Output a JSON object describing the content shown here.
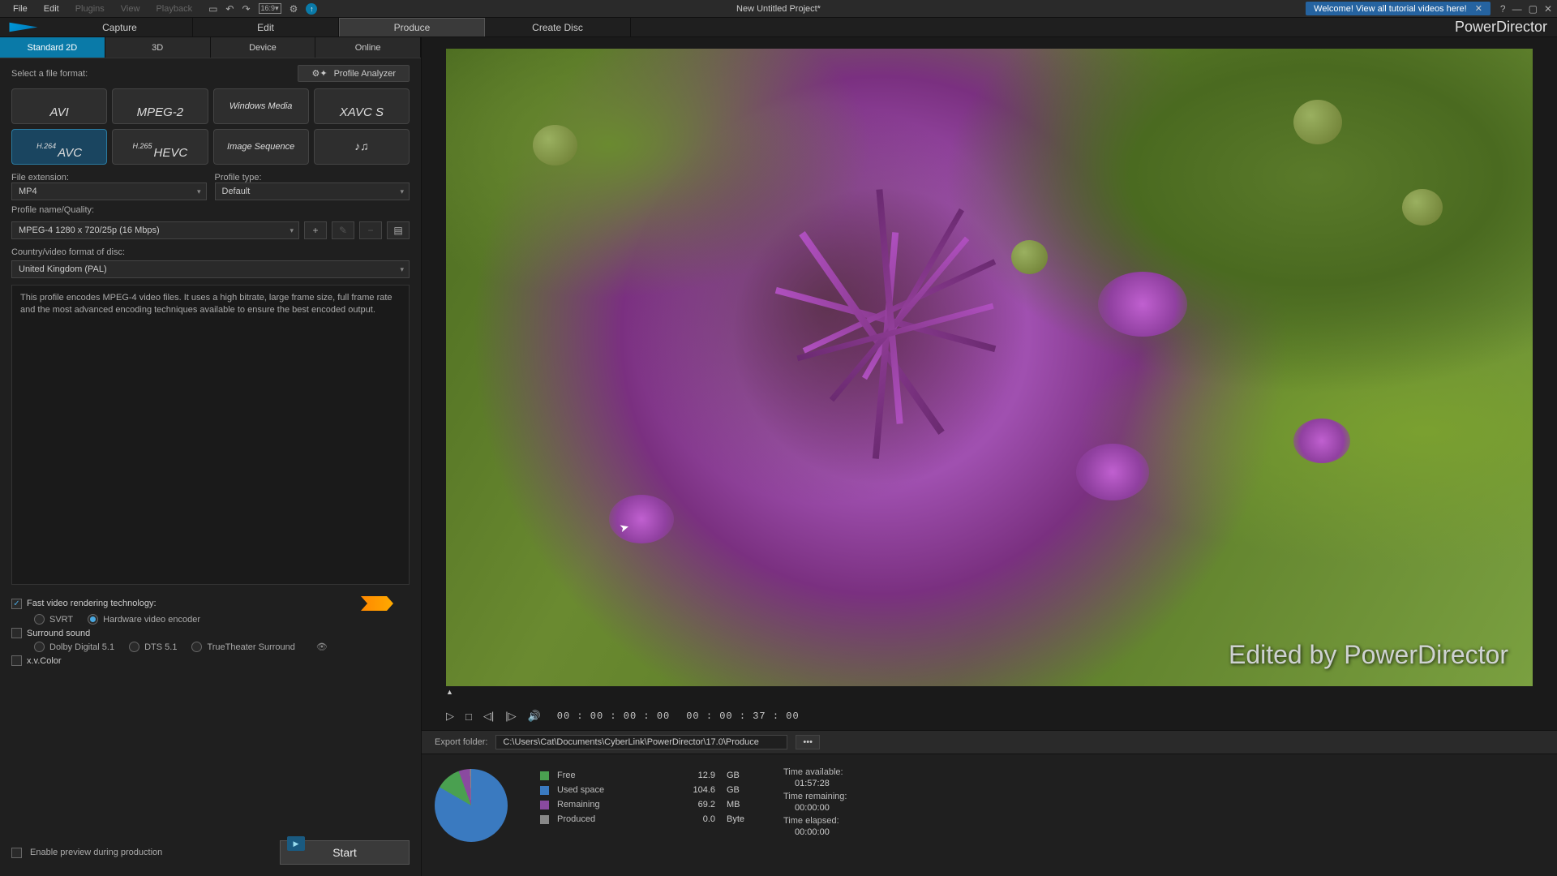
{
  "menubar": {
    "items": [
      "File",
      "Edit",
      "Plugins",
      "View",
      "Playback"
    ],
    "disabled_indices": [
      2,
      3,
      4
    ],
    "project_title": "New Untitled Project*",
    "welcome": "Welcome! View all tutorial videos here!"
  },
  "brand": "PowerDirector",
  "mode_tabs": [
    "Capture",
    "Edit",
    "Produce",
    "Create Disc"
  ],
  "mode_active": 2,
  "subtabs": [
    "Standard 2D",
    "3D",
    "Device",
    "Online"
  ],
  "subtab_active": 0,
  "format_label": "Select a file format:",
  "profile_analyzer": "Profile Analyzer",
  "formats": {
    "avi": "AVI",
    "mpeg2": "MPEG-2",
    "wm": "Windows Media",
    "xavcs": "XAVC S",
    "avc_pre": "H.264",
    "avc": "AVC",
    "hevc_pre": "H.265",
    "hevc": "HEVC",
    "imgseq": "Image Sequence",
    "audio_icon": "♪♫"
  },
  "fields": {
    "file_ext_label": "File extension:",
    "file_ext_value": "MP4",
    "profile_type_label": "Profile type:",
    "profile_type_value": "Default",
    "profile_name_label": "Profile name/Quality:",
    "profile_name_value": "MPEG-4 1280 x 720/25p (16 Mbps)",
    "country_label": "Country/video format of disc:",
    "country_value": "United Kingdom (PAL)"
  },
  "description": "This profile encodes MPEG-4 video files. It uses a high bitrate, large frame size, full frame rate and the most advanced encoding techniques available to ensure the best encoded output.",
  "options": {
    "fast_render": "Fast video rendering technology:",
    "svrt": "SVRT",
    "hw_encoder": "Hardware video encoder",
    "surround": "Surround sound",
    "dolby": "Dolby Digital 5.1",
    "dts": "DTS 5.1",
    "truetheater": "TrueTheater Surround",
    "xvcolor": "x.v.Color",
    "enable_preview": "Enable preview during production"
  },
  "start_label": "Start",
  "watermark": "Edited by PowerDirector",
  "playback": {
    "current": "00 : 00 : 00 : 00",
    "total": "00 : 00 : 37 : 00"
  },
  "export": {
    "label": "Export folder:",
    "path": "C:\\Users\\Cat\\Documents\\CyberLink\\PowerDirector\\17.0\\Produce",
    "browse": "•••"
  },
  "disk": {
    "free_label": "Free",
    "free_val": "12.9",
    "free_unit": "GB",
    "used_label": "Used space",
    "used_val": "104.6",
    "used_unit": "GB",
    "rem_label": "Remaining",
    "rem_val": "69.2",
    "rem_unit": "MB",
    "prod_label": "Produced",
    "prod_val": "0.0",
    "prod_unit": "Byte"
  },
  "times": {
    "avail_label": "Time available:",
    "avail_val": "01:57:28",
    "remain_label": "Time remaining:",
    "remain_val": "00:00:00",
    "elapsed_label": "Time elapsed:",
    "elapsed_val": "00:00:00"
  }
}
